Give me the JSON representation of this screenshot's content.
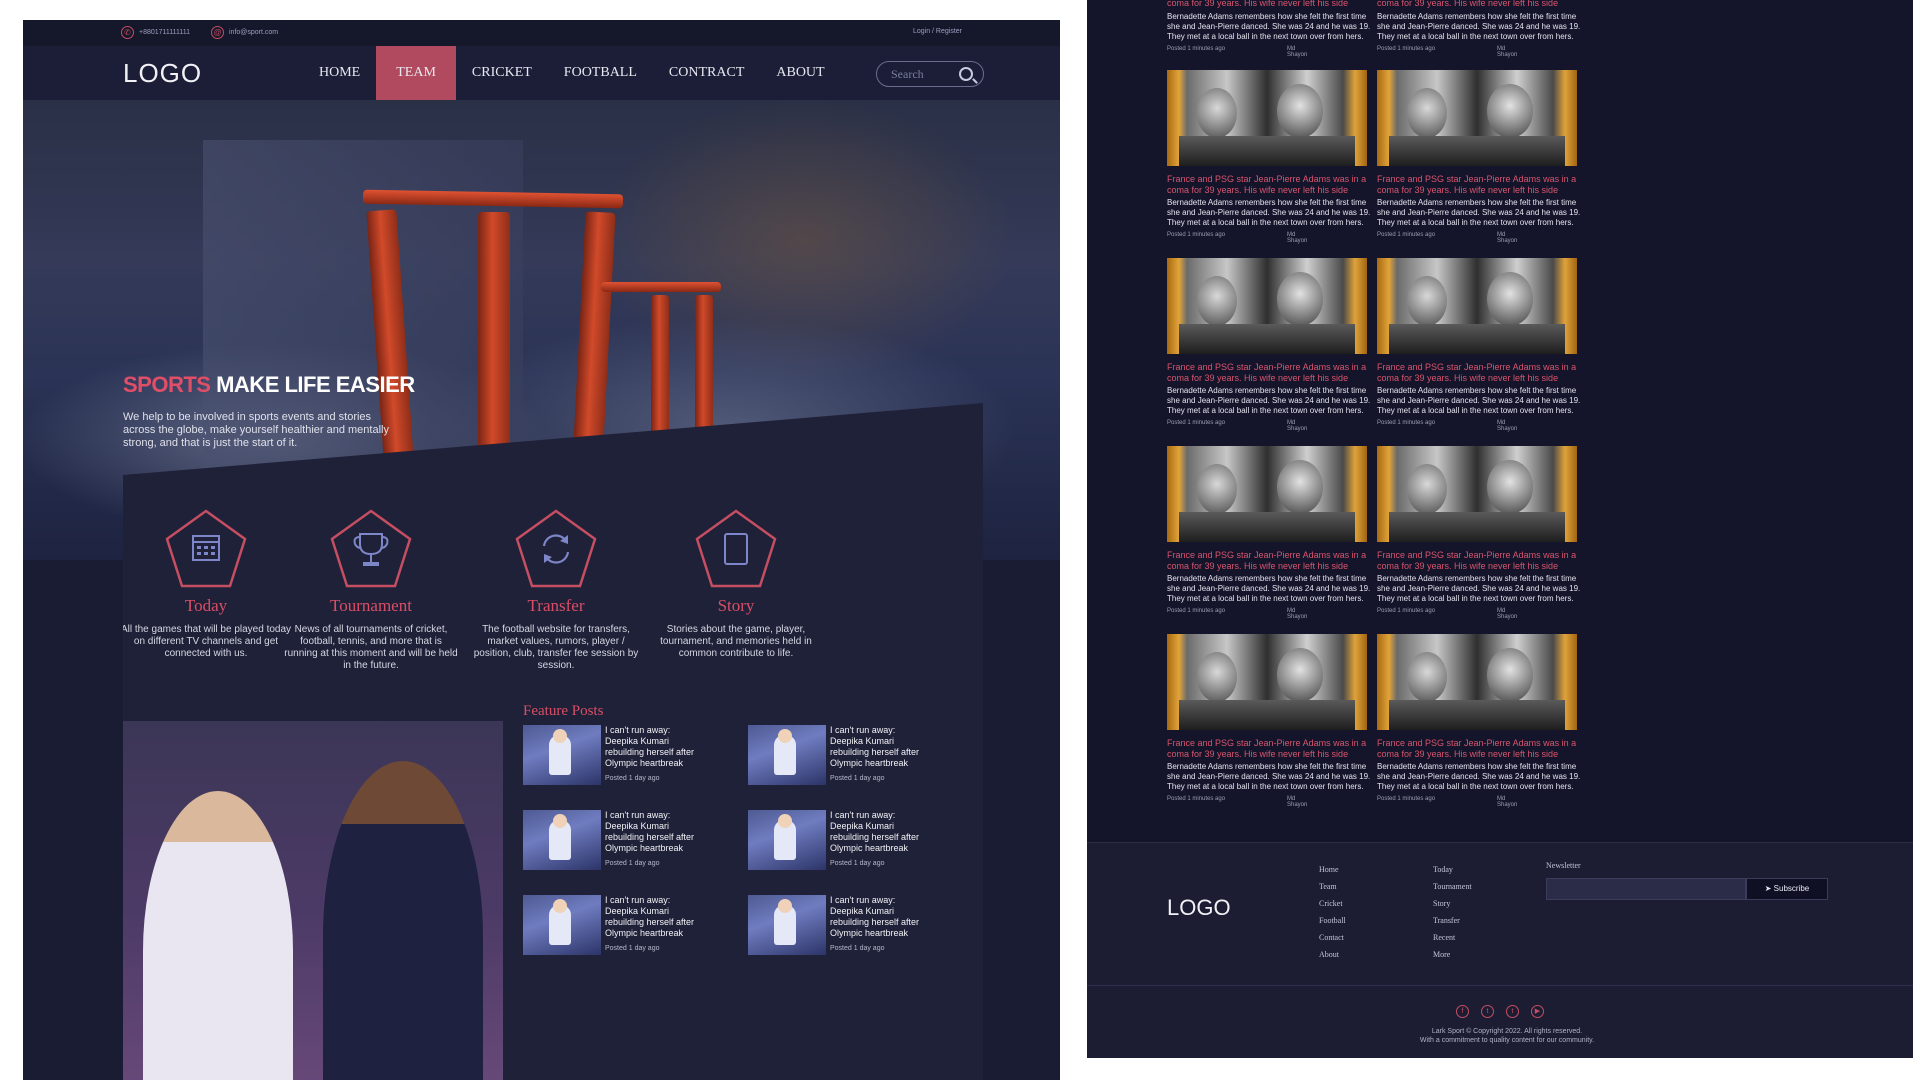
{
  "topbar": {
    "phone": "+8801711111111",
    "email": "info@sport.com",
    "login": "Login / Register"
  },
  "logo": "LOGO",
  "nav": {
    "items": [
      "HOME",
      "TEAM",
      "CRICKET",
      "FOOTBALL",
      "CONTRACT",
      "ABOUT"
    ],
    "active": "TEAM"
  },
  "search": {
    "placeholder": "Search"
  },
  "hero": {
    "title_accent": "SPORTS",
    "title_rest": "MAKE LIFE EASIER",
    "description": "We help to be involved in sports events and stories across the globe, make yourself healthier and mentally strong, and that is just the start of it."
  },
  "features": [
    {
      "icon": "calendar-icon",
      "title": "Today",
      "description": "All the games that will be played today on different TV channels and get connected with us."
    },
    {
      "icon": "trophy-icon",
      "title": "Tournament",
      "description": "News of all tournaments of cricket, football, tennis, and more that is running at this moment and will be held in the future."
    },
    {
      "icon": "transfer-icon",
      "title": "Transfer",
      "description": "The football website for transfers, market values, rumors, player / position, club, transfer fee session by session."
    },
    {
      "icon": "story-icon",
      "title": "Story",
      "description": "Stories about the game, player, tournament, and memories held in common contribute to life."
    }
  ],
  "feature_posts": {
    "title": "Feature Posts",
    "posts": [
      {
        "title": "I can't run away: Deepika Kumari rebuilding herself after Olympic heartbreak",
        "time": "Posted 1 day ago"
      },
      {
        "title": "I can't run away: Deepika Kumari rebuilding herself after Olympic heartbreak",
        "time": "Posted 1 day ago"
      },
      {
        "title": "I can't run away: Deepika Kumari rebuilding herself after Olympic heartbreak",
        "time": "Posted 1 day ago"
      },
      {
        "title": "I can't run away: Deepika Kumari rebuilding herself after Olympic heartbreak",
        "time": "Posted 1 day ago"
      },
      {
        "title": "I can't run away: Deepika Kumari rebuilding herself after Olympic heartbreak",
        "time": "Posted 1 day ago"
      },
      {
        "title": "I can't run away: Deepika Kumari rebuilding herself after Olympic heartbreak",
        "time": "Posted 1 day ago"
      }
    ]
  },
  "news": {
    "title": "France and PSG star Jean-Pierre Adams was in a coma for 39 years. His wife never left his side",
    "description": "Bernadette Adams remembers how she felt the first time she and Jean-Pierre danced. She was 24 and he was 19. They met at a local ball in the next town over from hers.",
    "time": "Posted 1 minutes ago",
    "author": "Md Shayon",
    "top_title_fragment": "coma for 39 years. His wife never left his side"
  },
  "footer": {
    "logo": "LOGO",
    "col1": [
      "Home",
      "Team",
      "Cricket",
      "Football",
      "Contact",
      "About"
    ],
    "col2": [
      "Today",
      "Tournament",
      "Story",
      "Transfer",
      "Recent",
      "More"
    ],
    "newsletter_label": "Newsletter",
    "subscribe": "Subscribe",
    "socials": [
      "facebook-icon",
      "twitter-icon",
      "twitter-icon",
      "youtube-icon"
    ],
    "copyright": "Lark Sport © Copyright 2022. All rights reserved.",
    "tagline": "With a commitment to quality content for our community."
  },
  "colors": {
    "accent": "#d94e66",
    "nav_active": "#b14a5f",
    "bg_dark": "#14142b",
    "panel": "#1f2138"
  }
}
